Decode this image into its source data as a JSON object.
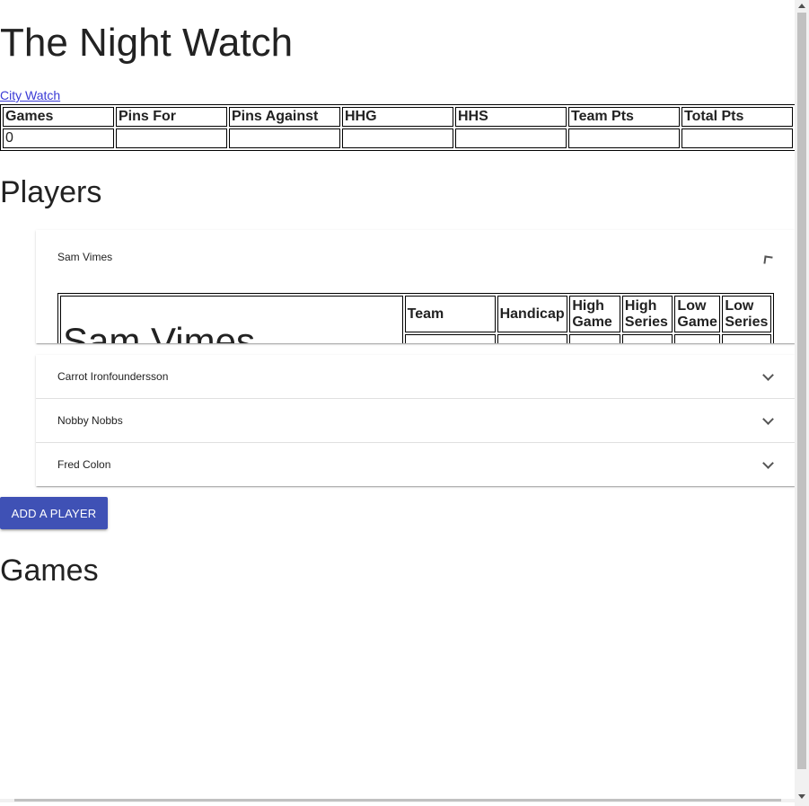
{
  "page": {
    "title": "The Night Watch"
  },
  "team_link": "City Watch",
  "team_stats": {
    "headers": [
      "Games",
      "Pins For",
      "Pins Against",
      "HHG",
      "HHS",
      "Team Pts",
      "Total Pts"
    ],
    "values": [
      "0",
      "",
      "",
      "",
      "",
      "",
      ""
    ]
  },
  "players_heading": "Players",
  "players": [
    {
      "name": "Sam Vimes",
      "expanded": true
    },
    {
      "name": "Carrot Ironfoundersson",
      "expanded": false
    },
    {
      "name": "Nobby Nobbs",
      "expanded": false
    },
    {
      "name": "Fred Colon",
      "expanded": false
    }
  ],
  "player_detail": {
    "name": "Sam Vimes",
    "headers": [
      "Team",
      "Handicap",
      "High Game",
      "High Series",
      "Low Game",
      "Low Series"
    ]
  },
  "add_player_label": "ADD A PLAYER",
  "games_heading": "Games",
  "icons": {
    "expand": "chevron-down-icon",
    "collapse": "chevron-up-icon"
  },
  "colors": {
    "primary_button": "#3f51b5",
    "link": "#3b3bd6"
  }
}
